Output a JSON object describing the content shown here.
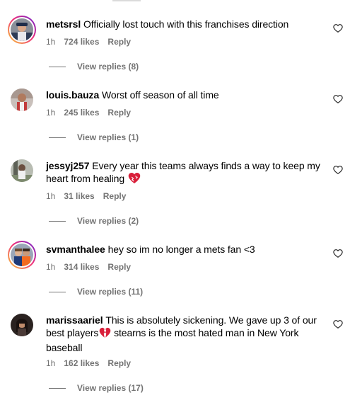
{
  "comments": [
    {
      "username": "metsrsl",
      "text": "Officially lost touch with this franchises direction",
      "emoji": "",
      "text_after": "",
      "time": "1h",
      "likes": "724 likes",
      "reply": "Reply",
      "view_replies": "View replies (8)",
      "has_story": true
    },
    {
      "username": "louis.bauza",
      "text": "Worst off season of all time",
      "emoji": "",
      "text_after": "",
      "time": "1h",
      "likes": "245 likes",
      "reply": "Reply",
      "view_replies": "View replies (1)",
      "has_story": false
    },
    {
      "username": "jessyj257",
      "text": "Every year this teams always finds a way to keep my heart from healing",
      "emoji": "mending-heart",
      "text_after": "",
      "time": "1h",
      "likes": "31 likes",
      "reply": "Reply",
      "view_replies": "View replies (2)",
      "has_story": false
    },
    {
      "username": "svmanthalee",
      "text": "hey so im no longer a mets fan <3",
      "emoji": "",
      "text_after": "",
      "time": "1h",
      "likes": "314 likes",
      "reply": "Reply",
      "view_replies": "View replies (11)",
      "has_story": true
    },
    {
      "username": "marissaariel",
      "text": "This is absolutely sickening. We gave up 3 of our best players",
      "emoji": "broken-heart",
      "text_after": " stearns is the most hated man in New York baseball",
      "time": "1h",
      "likes": "162 likes",
      "reply": "Reply",
      "view_replies": "View replies (17)",
      "has_story": false
    }
  ],
  "colors": {
    "text": "#000000",
    "secondary": "#737373",
    "story_ring_start": "#f9ce34",
    "story_ring_mid": "#ee2a7b",
    "story_ring_end": "#6228d7"
  },
  "icons": {
    "like": "heart-outline-icon",
    "emoji_mending": "mending-heart-emoji",
    "emoji_broken": "broken-heart-emoji"
  }
}
